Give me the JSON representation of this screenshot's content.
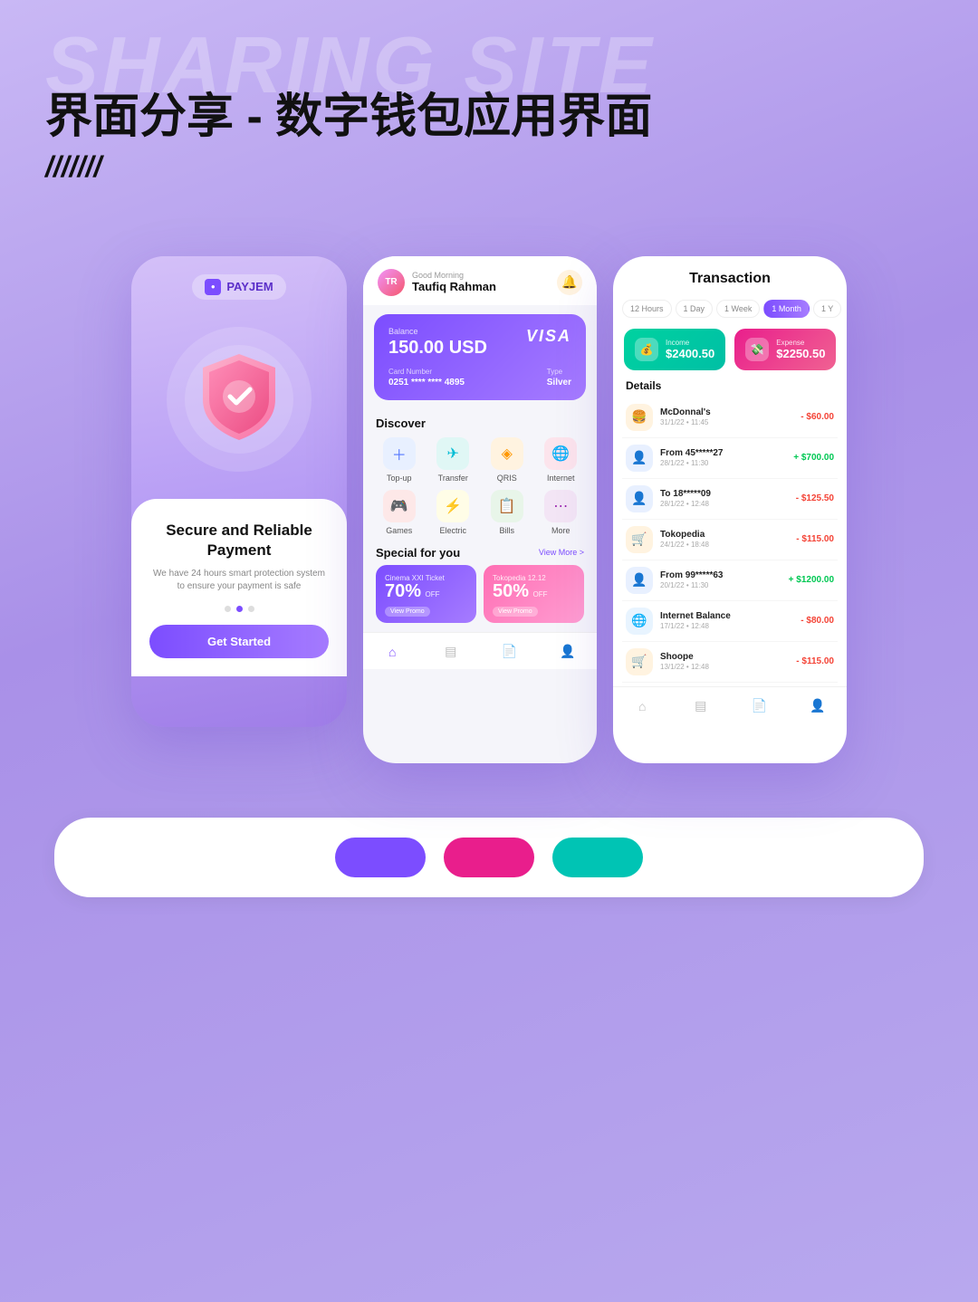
{
  "header": {
    "bg_text": "SHARING SITE",
    "main_title": "界面分享 - 数字钱包应用界面",
    "slash": "///////"
  },
  "phone1": {
    "logo_name": "PAYJEM",
    "title": "Secure and Reliable Payment",
    "subtitle": "We have 24 hours smart protection system to ensure your payment is safe",
    "btn_label": "Get Started"
  },
  "phone2": {
    "greeting": "Good Morning",
    "user_name": "Taufiq Rahman",
    "card": {
      "balance_label": "Balance",
      "balance": "150.00 USD",
      "network": "VISA",
      "number_label": "Card Number",
      "number": "0251 **** **** 4895",
      "type_label": "Type",
      "type": "Silver"
    },
    "discover_title": "Discover",
    "discover_items": [
      {
        "label": "Top-up",
        "icon": "＋"
      },
      {
        "label": "Transfer",
        "icon": "✈"
      },
      {
        "label": "QRIS",
        "icon": "◈"
      },
      {
        "label": "Internet",
        "icon": "🌐"
      },
      {
        "label": "Games",
        "icon": "🎮"
      },
      {
        "label": "Electric",
        "icon": "⚡"
      },
      {
        "label": "Bills",
        "icon": "📋"
      },
      {
        "label": "More",
        "icon": "⋯"
      }
    ],
    "special_title": "Special for you",
    "view_more": "View More >",
    "promos": [
      {
        "title": "Cinema XXI Ticket",
        "pct": "70%",
        "off": "OFF",
        "btn": "View Promo"
      },
      {
        "title": "Tokopedia 12.12",
        "pct": "50%",
        "off": "OFF",
        "btn": "View Promo"
      }
    ]
  },
  "phone3": {
    "title": "Transaction",
    "time_filters": [
      "12 Hours",
      "1 Day",
      "1 Week",
      "1 Month",
      "1 Y"
    ],
    "active_filter": "1 Month",
    "income": {
      "label": "Income",
      "value": "$2400.50"
    },
    "expense": {
      "label": "Expense",
      "value": "$2250.50"
    },
    "details_title": "Details",
    "transactions": [
      {
        "name": "McDonnal's",
        "date": "31/1/22 • 11:45",
        "amount": "- $60.00",
        "type": "minus",
        "icon": "🍔",
        "color": "#fff3e0"
      },
      {
        "name": "From 45*****27",
        "date": "28/1/22 • 11:30",
        "amount": "+ $700.00",
        "type": "plus",
        "icon": "👤",
        "color": "#e8f0ff"
      },
      {
        "name": "To 18*****09",
        "date": "28/1/22 • 12:48",
        "amount": "- $125.50",
        "type": "minus",
        "icon": "👤",
        "color": "#e8f0ff"
      },
      {
        "name": "Tokopedia",
        "date": "24/1/22 • 18:48",
        "amount": "- $115.00",
        "type": "minus",
        "icon": "🛒",
        "color": "#fff3e0"
      },
      {
        "name": "From 99*****63",
        "date": "20/1/22 • 11:30",
        "amount": "+ $1200.00",
        "type": "plus",
        "icon": "👤",
        "color": "#e8f0ff"
      },
      {
        "name": "Internet Balance",
        "date": "17/1/22 • 12:48",
        "amount": "- $80.00",
        "type": "minus",
        "icon": "🌐",
        "color": "#e8f4ff"
      },
      {
        "name": "Shoope",
        "date": "13/1/22 • 12:48",
        "amount": "- $115.00",
        "type": "minus",
        "icon": "🛒",
        "color": "#fff3e0"
      }
    ]
  },
  "swatches": {
    "purple": "#7c4dff",
    "pink": "#e91e8c",
    "teal": "#00c4b4"
  }
}
